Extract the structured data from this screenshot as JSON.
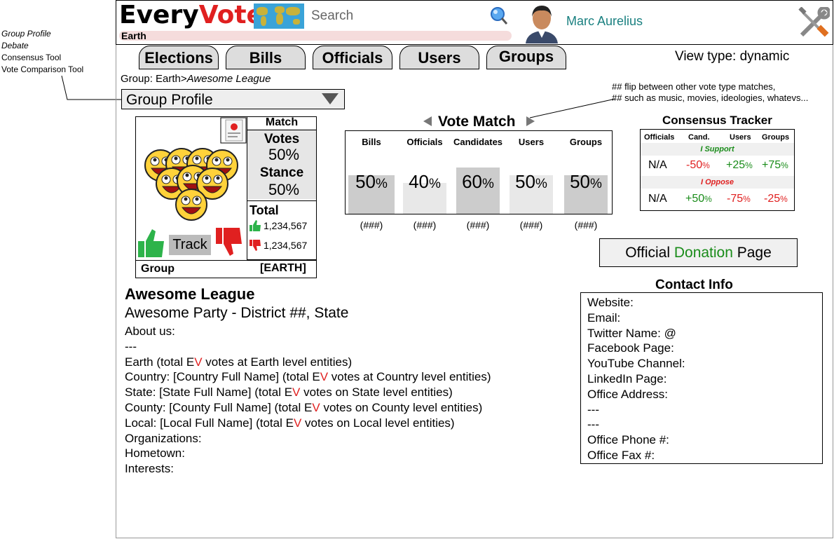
{
  "side_menu": [
    "Group Profile",
    "Debate",
    "Consensus Tool",
    "Vote Comparison Tool"
  ],
  "header": {
    "logo_left": "Every",
    "logo_right": "Vote",
    "search_placeholder": "Search",
    "location": "Earth",
    "user_name": "Marc Aurelius"
  },
  "tabs": [
    "Elections",
    "Bills",
    "Officials",
    "Users",
    "Groups"
  ],
  "view_type": "View type: dynamic",
  "breadcrumb": {
    "prefix": "Group: Earth>",
    "current": "Awesome League"
  },
  "dropdown": {
    "selected": "Group Profile"
  },
  "profile_card": {
    "match_label": "Match",
    "votes_label": "Votes",
    "votes_value": "50%",
    "stance_label": "Stance",
    "stance_value": "50%",
    "total_label": "Total",
    "total_up": "1,234,567",
    "total_down": "1,234,567",
    "track_label": "Track",
    "type_label": "Group",
    "scope_label": "[EARTH]"
  },
  "vote_match": {
    "title": "Vote Match",
    "columns": [
      {
        "label": "Bills",
        "value": "50",
        "count": "(###)"
      },
      {
        "label": "Officials",
        "value": "40",
        "count": "(###)"
      },
      {
        "label": "Candidates",
        "value": "60",
        "count": "(###)"
      },
      {
        "label": "Users",
        "value": "50",
        "count": "(###)"
      },
      {
        "label": "Groups",
        "value": "50",
        "count": "(###)"
      }
    ],
    "unit": "%"
  },
  "note": [
    "## flip between other vote type matches,",
    "## such as music, movies, ideologies, whatevs..."
  ],
  "consensus": {
    "title": "Consensus Tracker",
    "headers": [
      "Officials",
      "Cand.",
      "Users",
      "Groups"
    ],
    "support_label": "I Support",
    "oppose_label": "I Oppose",
    "support_row": {
      "officials": "N/A",
      "cand": "-50",
      "users": "+25",
      "groups": "+75"
    },
    "oppose_row": {
      "officials": "N/A",
      "cand": "+50",
      "users": "-75",
      "groups": "-25"
    },
    "unit": "%"
  },
  "donation": {
    "prefix": "Official ",
    "highlight": "Donation",
    "suffix": " Page"
  },
  "contact": {
    "title": "Contact Info",
    "lines": [
      "Website:",
      "Email:",
      "Twitter Name: @",
      "Facebook Page:",
      "YouTube Channel:",
      "LinkedIn Page:",
      "Office Address:",
      "---",
      "---",
      "Office Phone #:",
      "Office Fax #:"
    ]
  },
  "about": {
    "name": "Awesome League",
    "subtitle": "Awesome Party - District ##, State",
    "about_label": "About us:",
    "separator": "---",
    "levels": [
      {
        "prefix": "Earth (total E",
        "v": "V",
        "suffix": " votes at Earth level entities)"
      },
      {
        "prefix": "Country: [Country Full Name] (total E",
        "v": "V",
        "suffix": " votes at Country level entities)"
      },
      {
        "prefix": "State: [State Full Name] (total E",
        "v": "V",
        "suffix": " votes on State level entities)"
      },
      {
        "prefix": "County: [County Full Name] (total E",
        "v": "V",
        "suffix": " votes on County level entities)"
      },
      {
        "prefix": "Local: [Local Full Name] (total E",
        "v": "V",
        "suffix": " votes on Local level entities)"
      }
    ],
    "organizations": "Organizations:",
    "hometown": "Hometown:",
    "interests": "Interests:"
  },
  "colors": {
    "accent_red": "#e02020",
    "accent_green": "#1a8c1a",
    "user_teal": "#1a8080"
  }
}
